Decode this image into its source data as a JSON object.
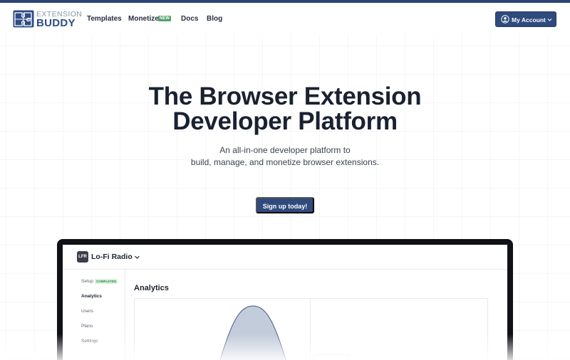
{
  "nav": {
    "logo_top": "EXTENSION",
    "logo_bottom": "BUDDY",
    "links": [
      "Templates",
      "Monetize",
      "Docs",
      "Blog"
    ],
    "new_badge": "NEW",
    "account_label": "My Account"
  },
  "hero": {
    "title_line1": "The Browser Extension",
    "title_line2": "Developer Platform",
    "subtitle_line1": "An all-in-one developer platform to",
    "subtitle_line2": "build, manage, and monetize browser extensions.",
    "cta_label": "Sign up today!"
  },
  "app": {
    "avatar_text": "LFR",
    "name": "Lo-Fi Radio",
    "sidebar": [
      "Setup",
      "Analytics",
      "Users",
      "Plans",
      "Settings"
    ],
    "active_item": "Analytics",
    "completed_badge": "COMPLETED",
    "main_title": "Analytics"
  },
  "colors": {
    "brand": "#2f4a7d",
    "accent_green": "#56a06a",
    "chart_fill": "#c3ccdb",
    "chart_stroke": "#3f5582"
  },
  "icons": {
    "logo": "puzzle-icon",
    "account": "user-circle-icon",
    "dropdown": "chevron-down-icon"
  }
}
